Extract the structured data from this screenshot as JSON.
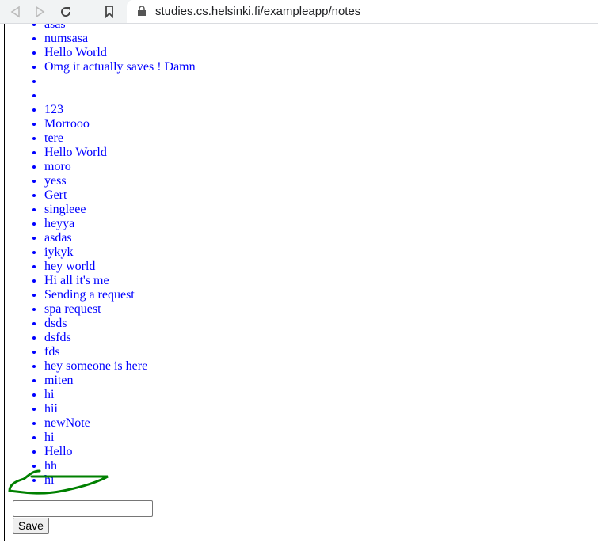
{
  "browser": {
    "url": "studies.cs.helsinki.fi/exampleapp/notes"
  },
  "notes": [
    "asas",
    "numsasa",
    "Hello World",
    "Omg it actually saves ! Damn",
    "",
    "",
    "123",
    "Morrooo",
    "tere",
    "Hello World",
    "moro",
    "yess",
    "Gert",
    "singleee",
    "heyya",
    "asdas",
    "iykyk",
    "hey world",
    "Hi all it's me",
    "Sending a request",
    "spa request",
    "dsds",
    "dsfds",
    "fds",
    "hey someone is here",
    "miten",
    "hi",
    "hii",
    "newNote",
    "hi",
    "Hello",
    "hh",
    "hi"
  ],
  "form": {
    "input_value": "",
    "save_label": "Save"
  },
  "colors": {
    "link": "#0000ff",
    "annotation": "#008000"
  }
}
